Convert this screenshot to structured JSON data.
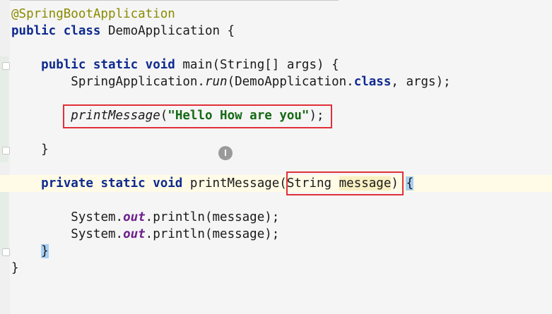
{
  "editor": {
    "lines": {
      "l1": {
        "annotation": "@SpringBootApplication"
      },
      "l2": {
        "kw": "public class",
        "name": " DemoApplication {"
      },
      "l4": {
        "indent": "    ",
        "kw": "public static void",
        "rest": " main(String[] args) {"
      },
      "l5": {
        "indent": "        ",
        "a": "SpringApplication.",
        "method": "run",
        "b": "(DemoApplication.",
        "kw": "class",
        "c": ", args);"
      },
      "l7": {
        "indent": "        ",
        "method": "printMessage",
        "open": "(",
        "string": "\"Hello How are you\"",
        "close": ");"
      },
      "l9": {
        "indent": "    ",
        "brace": "}"
      },
      "l11": {
        "indent": "    ",
        "kw": "private static void",
        "name": " printMessage(",
        "param_type": "String ",
        "param_name": "message",
        "close_paren": ")",
        "space": " ",
        "brace": "{"
      },
      "l13": {
        "indent": "        ",
        "a": "System.",
        "field": "out",
        "b": ".println(message);"
      },
      "l14": {
        "indent": "        ",
        "a": "System.",
        "field": "out",
        "b": ".println(message);"
      },
      "l15": {
        "indent": "    ",
        "brace": "}"
      },
      "l16": {
        "brace": "}"
      }
    },
    "colors": {
      "keyword": "#0f2a8f",
      "annotation": "#8a8a00",
      "string": "#156915",
      "static_field": "#6c1f8c",
      "highlight_box": "#e0303a",
      "brace_match": "#a8cff2"
    },
    "cursor": {
      "icon": "text-cursor-icon",
      "glyph": "𝐈"
    }
  }
}
